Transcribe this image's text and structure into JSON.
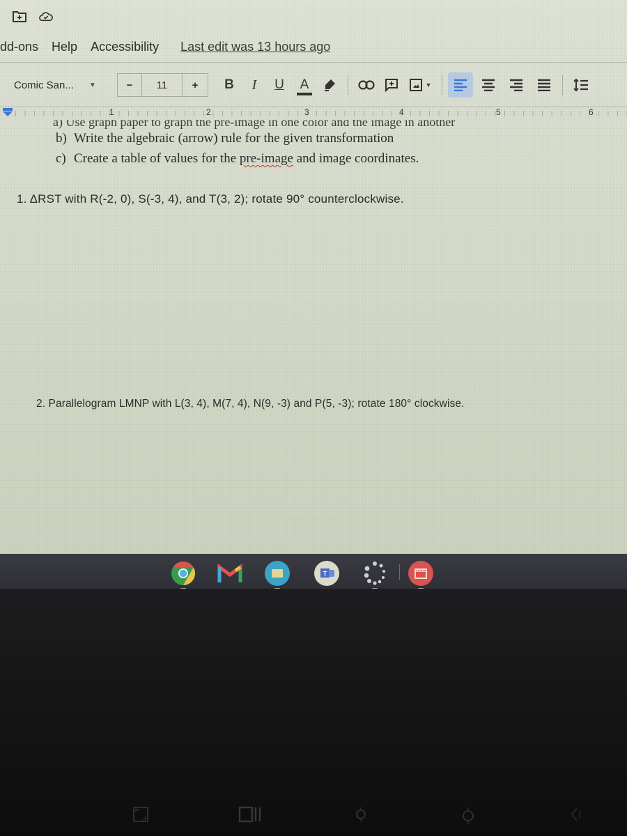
{
  "top_icons": [
    "move-to-folder-icon",
    "cloud-saved-icon"
  ],
  "menubar": {
    "items": [
      "dd-ons",
      "Help",
      "Accessibility"
    ],
    "last_edit": "Last edit was 13 hours ago"
  },
  "toolbar": {
    "font": "Comic San...",
    "font_size": "11",
    "minus": "−",
    "plus": "+",
    "bold": "B",
    "italic": "I",
    "underline": "U",
    "text_color": "A",
    "align_active": "left",
    "icons": [
      "highlight-icon",
      "link-icon",
      "comment-icon",
      "image-icon",
      "align-left-icon",
      "align-center-icon",
      "align-right-icon",
      "align-justify-icon",
      "line-spacing-icon"
    ]
  },
  "ruler": {
    "numbers": [
      "1",
      "2",
      "3",
      "4",
      "5",
      "6"
    ]
  },
  "document": {
    "line_a": "a)   Use graph paper to graph the pre-image in one color and the image in another",
    "line_b_label": "b)",
    "line_b": "Write the algebraic (arrow) rule for the given transformation",
    "line_c_label": "c)",
    "line_c_pre": "Create a table of values for the ",
    "line_c_spell": "pre-image",
    "line_c_post": " and image coordinates.",
    "problem_1": "1.  ΔRST with R(-2, 0), S(-3, 4), and T(3, 2); rotate 90° counterclockwise.",
    "problem_2": "2.  Parallelogram LMNP with L(3, 4), M(7, 4), N(9, -3) and P(5, -3); rotate 180° clockwise."
  },
  "shelf": {
    "apps": [
      "Chrome",
      "Gmail",
      "Files",
      "Teams",
      "Launcher",
      "Screen Recorder"
    ]
  },
  "keyboard_keys": [
    "fullscreen-key",
    "overview-key",
    "brightness-down-key",
    "brightness-up-key",
    "mute-key"
  ],
  "colors": {
    "screen_bg": "#d9ddd0",
    "shelf_bg": "#35363d",
    "align_active_bg": "#b8cbe0",
    "ruler_marker": "#3b78d8"
  }
}
